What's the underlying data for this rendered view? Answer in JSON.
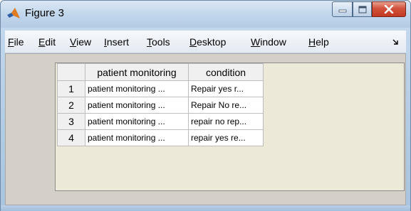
{
  "window": {
    "title": "Figure 3",
    "icon": "matlab-icon",
    "controls": {
      "minimize": "minimize-icon",
      "maximize": "maximize-icon",
      "close": "close-icon"
    }
  },
  "menubar": {
    "items": [
      {
        "mnemonic": "F",
        "rest": "ile"
      },
      {
        "mnemonic": "E",
        "rest": "dit"
      },
      {
        "mnemonic": "V",
        "rest": "iew"
      },
      {
        "mnemonic": "I",
        "rest": "nsert"
      },
      {
        "mnemonic": "T",
        "rest": "ools"
      },
      {
        "mnemonic": "D",
        "rest": "esktop"
      },
      {
        "mnemonic": "W",
        "rest": "indow"
      },
      {
        "mnemonic": "H",
        "rest": "elp"
      }
    ],
    "overflow_icon": "dock-arrow-icon"
  },
  "table": {
    "columns": [
      "patient monitoring",
      "condition"
    ],
    "rows": [
      {
        "index": "1",
        "cells": [
          "patient monitoring ...",
          "Repair yes r..."
        ]
      },
      {
        "index": "2",
        "cells": [
          "patient monitoring ...",
          "Repair No re..."
        ]
      },
      {
        "index": "3",
        "cells": [
          "patient monitoring ...",
          "repair no rep..."
        ]
      },
      {
        "index": "4",
        "cells": [
          "patient monitoring ...",
          "repair yes re..."
        ]
      }
    ]
  },
  "colors": {
    "close_button": "#c23a22",
    "figure_background": "#d4d0c8",
    "titlebar": "#c2d7ec"
  }
}
